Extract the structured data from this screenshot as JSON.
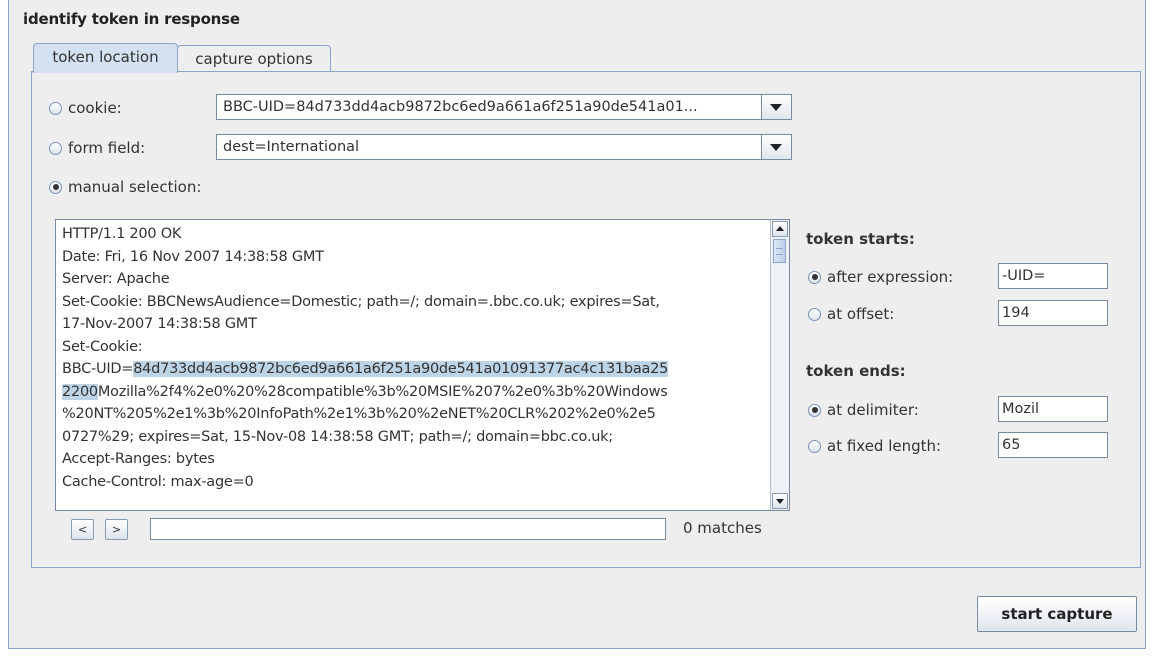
{
  "group_title": "identify token in response",
  "tabs": [
    {
      "label": "token location",
      "active": true
    },
    {
      "label": "capture options",
      "active": false
    }
  ],
  "source_options": {
    "cookie": {
      "label": "cookie:",
      "selected": false,
      "value": "BBC-UID=84d733dd4acb9872bc6ed9a661a6f251a90de541a01..."
    },
    "form_field": {
      "label": "form field:",
      "selected": false,
      "value": "dest=International"
    },
    "manual": {
      "label": "manual selection:",
      "selected": true
    }
  },
  "response_text": {
    "line1": "HTTP/1.1 200 OK",
    "line2": "Date: Fri, 16 Nov 2007 14:38:58 GMT",
    "line3": "Server: Apache",
    "line4": "Set-Cookie: BBCNewsAudience=Domestic; path=/; domain=.bbc.co.uk; expires=Sat,",
    "line5": "17-Nov-2007 14:38:58 GMT",
    "line6": "Set-Cookie:",
    "line7_pre": "BBC-UID=",
    "line7_hl": "84d733dd4acb9872bc6ed9a661a6f251a90de541a01091377ac4c131baa25",
    "line8_hl": "2200",
    "line8_post": "Mozilla%2f4%2e0%20%28compatible%3b%20MSIE%207%2e0%3b%20Windows",
    "line9": "%20NT%205%2e1%3b%20InfoPath%2e1%3b%20%2eNET%20CLR%202%2e0%2e5",
    "line10": "0727%29; expires=Sat, 15-Nov-08 14:38:58 GMT; path=/; domain=bbc.co.uk;",
    "line11": "Accept-Ranges: bytes",
    "line12": "Cache-Control: max-age=0"
  },
  "find": {
    "prev_label": "<",
    "next_label": ">",
    "query": "",
    "matches_text": "0 matches"
  },
  "token_starts": {
    "title": "token starts:",
    "after_expression": {
      "label": "after expression:",
      "selected": true,
      "value": "-UID="
    },
    "at_offset": {
      "label": "at offset:",
      "selected": false,
      "value": "194"
    }
  },
  "token_ends": {
    "title": "token ends:",
    "at_delimiter": {
      "label": "at delimiter:",
      "selected": true,
      "value": "Mozil"
    },
    "at_fixed_length": {
      "label": "at fixed length:",
      "selected": false,
      "value": "65"
    }
  },
  "start_button_label": "start capture",
  "colors": {
    "panel_bg": "#eeeeee",
    "tab_active_bg": "#d3e1f0",
    "border_blue": "#8aa6c9",
    "highlight": "#bdd3e6"
  }
}
